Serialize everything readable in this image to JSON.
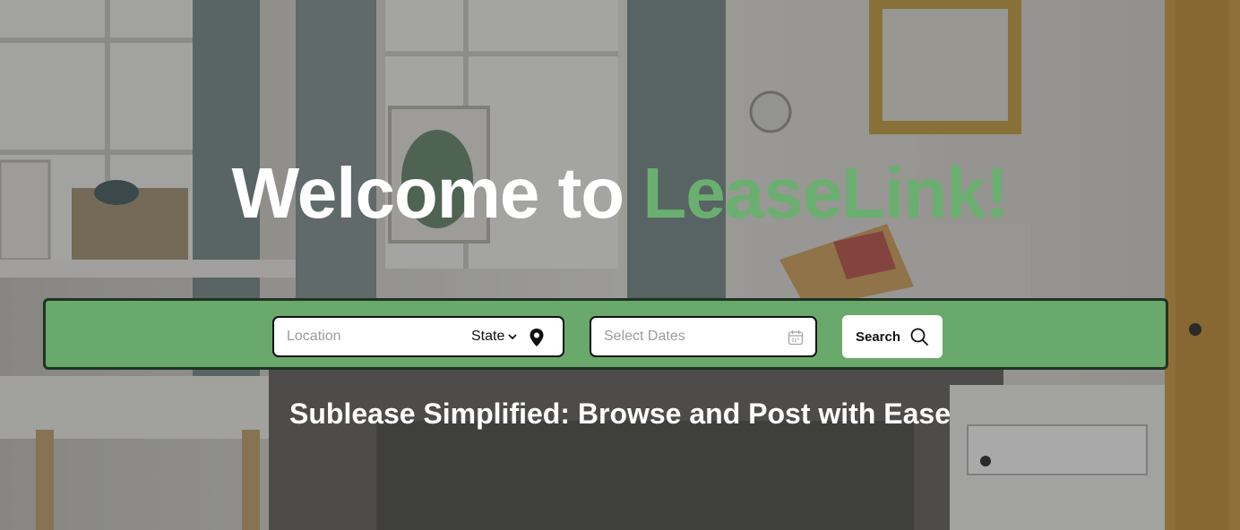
{
  "hero": {
    "headline_prefix": "Welcome to ",
    "headline_brand": "LeaseLink!",
    "tagline": "Sublease Simplified: Browse and Post with Ease"
  },
  "search": {
    "location_placeholder": "Location",
    "location_value": "",
    "state_label": "State",
    "dates_placeholder": "Select Dates",
    "dates_value": "",
    "button_label": "Search"
  },
  "icons": {
    "state_dropdown": "chevron-down-icon",
    "location": "map-pin-icon",
    "dates": "calendar-icon",
    "search": "search-icon"
  },
  "colors": {
    "brand_green": "#6aaf70",
    "search_bar_bg": "#69a96c",
    "search_bar_border": "#1f3322",
    "text_light": "#ffffff"
  }
}
